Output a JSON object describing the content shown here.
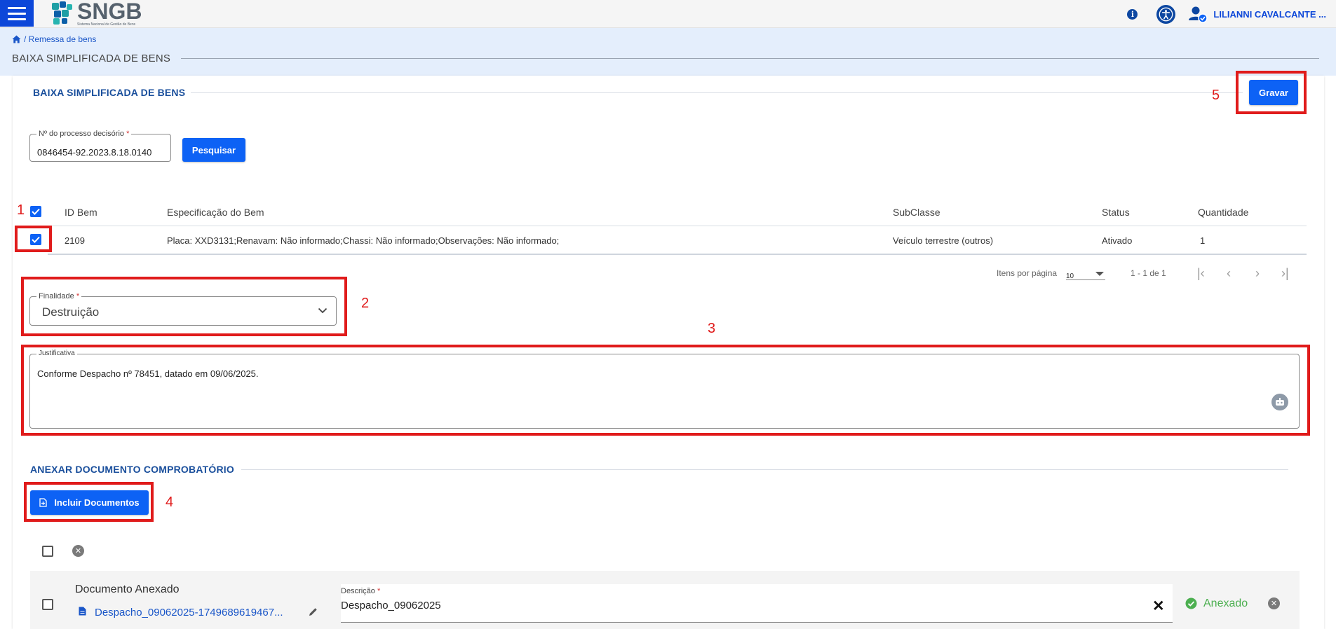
{
  "app": {
    "logo_title": "SNGB",
    "logo_subtitle": "Sistema Nacional de Gestão de Bens",
    "user_name": "LILIANNI CAVALCANTE ..."
  },
  "breadcrumb": {
    "label": "/ Remessa de bens"
  },
  "page": {
    "title": "BAIXA SIMPLIFICADA DE BENS"
  },
  "form": {
    "section_title": "BAIXA SIMPLIFICADA DE BENS",
    "save_label": "Gravar",
    "processo": {
      "label": "Nº do processo decisório",
      "required": "*",
      "value": "0846454-92.2023.8.18.0140"
    },
    "search_label": "Pesquisar"
  },
  "table": {
    "headers": [
      "ID Bem",
      "Especificação do Bem",
      "SubClasse",
      "Status",
      "Quantidade"
    ],
    "rows": [
      {
        "id": "2109",
        "spec": "Placa: XXD3131;Renavam: Não informado;Chassi: Não informado;Observações: Não informado;",
        "subclass": "Veículo terrestre (outros)",
        "status": "Ativado",
        "quantity": "1"
      }
    ],
    "paginator": {
      "items_label": "Itens por página",
      "page_size": "10",
      "range": "1 - 1 de 1"
    }
  },
  "finalidade": {
    "label": "Finalidade",
    "required": "*",
    "value": "Destruição"
  },
  "justificativa": {
    "label": "Justificativa",
    "value": "Conforme Despacho nº 78451, datado em 09/06/2025."
  },
  "anexar": {
    "section_title": "ANEXAR DOCUMENTO COMPROBATÓRIO",
    "include_label": "Incluir Documentos",
    "doc": {
      "header": "Documento Anexado",
      "filename": "Despacho_09062025-1749689619467...",
      "desc_label": "Descrição",
      "desc_required": "*",
      "desc_value": "Despacho_09062025",
      "status": "Anexado"
    }
  },
  "annotations": [
    "1",
    "2",
    "3",
    "4",
    "5"
  ],
  "colors": {
    "primary": "#0d62f5",
    "brand": "#0d47d9",
    "annotation": "#e01b1b",
    "success": "#4caf50"
  }
}
